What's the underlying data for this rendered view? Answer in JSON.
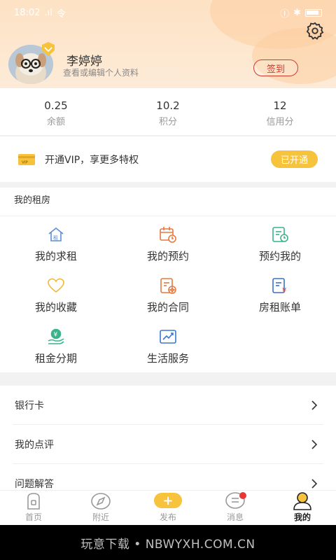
{
  "status_bar": {
    "time": "18:02",
    "signal": ".ıl",
    "wifi": "令",
    "extra": "Ⓘ"
  },
  "header": {
    "username": "李婷婷",
    "subtitle": "查看或编辑个人资料",
    "signin_label": "签到"
  },
  "stats": [
    {
      "value": "0.25",
      "label": "余额"
    },
    {
      "value": "10.2",
      "label": "积分"
    },
    {
      "value": "12",
      "label": "信用分"
    }
  ],
  "vip": {
    "text": "开通VIP，享更多特权",
    "card_text": "VIP",
    "button": "已开通"
  },
  "rental": {
    "title": "我的租房",
    "items": [
      {
        "label": "我的求租",
        "icon": "house-icon"
      },
      {
        "label": "我的预约",
        "icon": "calendar-icon"
      },
      {
        "label": "预约我的",
        "icon": "document-clock-icon"
      },
      {
        "label": "我的收藏",
        "icon": "heart-icon"
      },
      {
        "label": "我的合同",
        "icon": "contract-icon"
      },
      {
        "label": "房租账单",
        "icon": "bill-icon"
      },
      {
        "label": "租金分期",
        "icon": "coin-hand-icon"
      },
      {
        "label": "生活服务",
        "icon": "chart-icon"
      }
    ]
  },
  "list": [
    {
      "label": "银行卡"
    },
    {
      "label": "我的点评"
    },
    {
      "label": "问题解答"
    }
  ],
  "tabs": [
    {
      "label": "首页",
      "icon": "home-icon"
    },
    {
      "label": "附近",
      "icon": "compass-icon"
    },
    {
      "label": "发布",
      "icon": "plus-icon",
      "symbol": "+"
    },
    {
      "label": "消息",
      "icon": "message-icon"
    },
    {
      "label": "我的",
      "icon": "person-icon"
    }
  ],
  "watermark": "玩意下载 • NBWYXH.COM.CN",
  "colors": {
    "accent": "#f7c23c",
    "signin": "#d23a2c",
    "header_bg": "#fde2c4"
  }
}
